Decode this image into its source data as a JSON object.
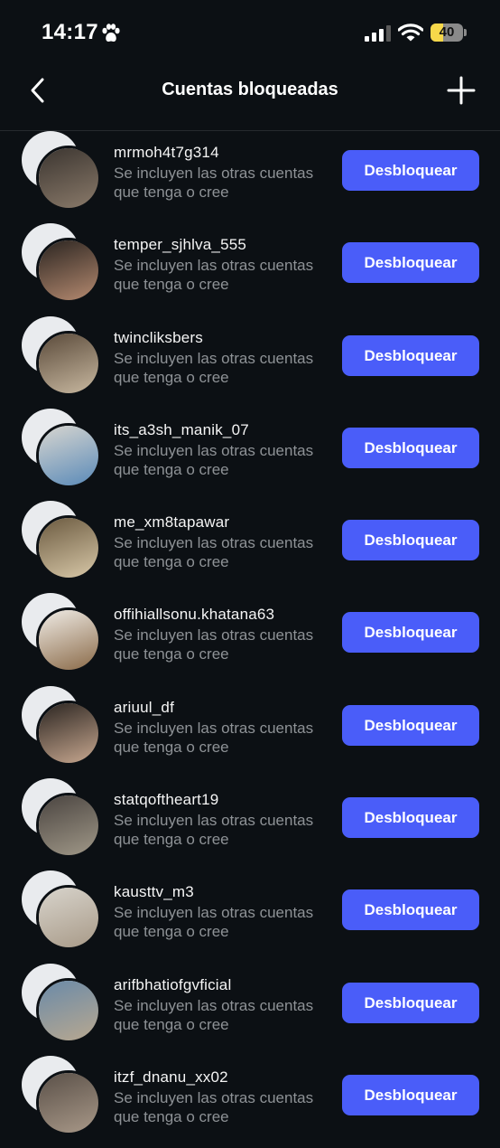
{
  "status_bar": {
    "time": "14:17",
    "battery": "40",
    "battery_level": 0.4
  },
  "header": {
    "title": "Cuentas bloqueadas",
    "back_icon": "chevron-left-icon",
    "add_icon": "plus-icon"
  },
  "subtitle_line1": "Se incluyen las otras cuentas",
  "subtitle_line2": "que tenga o cree",
  "unblock_label": "Desbloquear",
  "accounts": [
    {
      "username": "mrmoh4t7g314",
      "colors": [
        "#3b3530",
        "#8a7a6a"
      ]
    },
    {
      "username": "temper_sjhlva_555",
      "colors": [
        "#2a2420",
        "#b58a70"
      ]
    },
    {
      "username": "twincliksbers",
      "colors": [
        "#5a4a3a",
        "#c8b8a0"
      ]
    },
    {
      "username": "its_a3sh_manik_07",
      "colors": [
        "#d8d6d0",
        "#5a8ab8"
      ]
    },
    {
      "username": "me_xm8tapawar",
      "colors": [
        "#6b5a40",
        "#d8c8a8"
      ]
    },
    {
      "username": "offihiallsonu.khatana63",
      "colors": [
        "#f0ece6",
        "#8a6a48"
      ]
    },
    {
      "username": "ariuul_df",
      "colors": [
        "#2a2420",
        "#c8a890"
      ]
    },
    {
      "username": "statqoftheart19",
      "colors": [
        "#4a4440",
        "#a09888"
      ]
    },
    {
      "username": "kausttv_m3",
      "colors": [
        "#d8d4cc",
        "#a89a88"
      ]
    },
    {
      "username": "arifbhatiofgvficial",
      "colors": [
        "#6a8aa8",
        "#b8a890"
      ]
    },
    {
      "username": "itzf_dnanu_xx02",
      "colors": [
        "#5a5048",
        "#a89888"
      ]
    }
  ]
}
